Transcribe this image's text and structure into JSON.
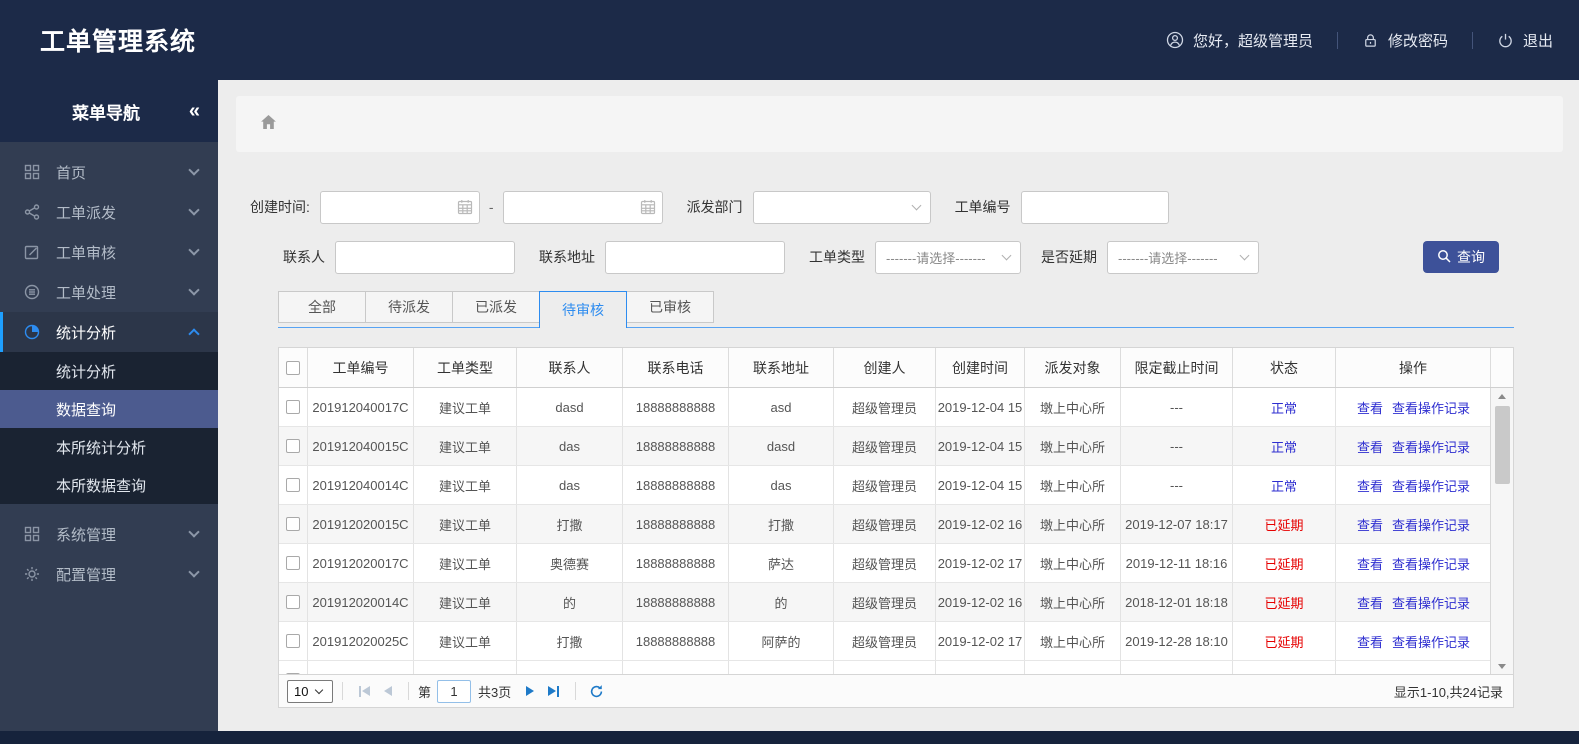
{
  "header": {
    "title": "工单管理系统",
    "greeting": "您好，超级管理员",
    "change_password": "修改密码",
    "logout": "退出"
  },
  "sidebar": {
    "title": "菜单导航",
    "collapse_glyph": "«",
    "menu": [
      {
        "type": "item",
        "icon": "grid-icon",
        "label": "首页"
      },
      {
        "type": "item",
        "icon": "share-icon",
        "label": "工单派发"
      },
      {
        "type": "item",
        "icon": "edit-icon",
        "label": "工单审核"
      },
      {
        "type": "item",
        "icon": "database-icon",
        "label": "工单处理"
      },
      {
        "type": "item",
        "icon": "pie-icon",
        "label": "统计分析",
        "active": true,
        "expanded": true
      },
      {
        "type": "subitem",
        "label": "统计分析"
      },
      {
        "type": "subitem",
        "label": "数据查询",
        "selected": true
      },
      {
        "type": "subitem",
        "label": "本所统计分析"
      },
      {
        "type": "subitem",
        "label": "本所数据查询"
      },
      {
        "type": "item",
        "icon": "grid-icon",
        "label": "系统管理"
      },
      {
        "type": "item",
        "icon": "gear-icon",
        "label": "配置管理"
      }
    ]
  },
  "filters": {
    "create_time_label": "创建时间:",
    "create_time_start": "",
    "create_time_end": "",
    "range_separator": "-",
    "dispatch_dept_label": "派发部门",
    "dispatch_dept_value": "",
    "order_no_label": "工单编号",
    "order_no_value": "",
    "contact_label": "联系人",
    "contact_value": "",
    "address_label": "联系地址",
    "address_value": "",
    "order_type_label": "工单类型",
    "order_type_value": "-------请选择-------",
    "delay_label": "是否延期",
    "delay_value": "-------请选择-------",
    "search_button": "查询"
  },
  "tabs": [
    {
      "label": "全部"
    },
    {
      "label": "待派发"
    },
    {
      "label": "已派发"
    },
    {
      "label": "待审核",
      "active": true
    },
    {
      "label": "已审核"
    }
  ],
  "table": {
    "columns": [
      "工单编号",
      "工单类型",
      "联系人",
      "联系电话",
      "联系地址",
      "创建人",
      "创建时间",
      "派发对象",
      "限定截止时间",
      "状态",
      "操作"
    ],
    "actions": {
      "view": "查看",
      "view_records": "查看操作记录"
    },
    "rows": [
      {
        "no": "201912040017C",
        "type": "建议工单",
        "contact": "dasd",
        "phone": "18888888888",
        "address": "asd",
        "creator": "超级管理员",
        "created": "2019-12-04 15",
        "target": "墩上中心所",
        "deadline": "---",
        "status": "正常",
        "delayed": false
      },
      {
        "no": "201912040015C",
        "type": "建议工单",
        "contact": "das",
        "phone": "18888888888",
        "address": "dasd",
        "creator": "超级管理员",
        "created": "2019-12-04 15",
        "target": "墩上中心所",
        "deadline": "---",
        "status": "正常",
        "delayed": false
      },
      {
        "no": "201912040014C",
        "type": "建议工单",
        "contact": "das",
        "phone": "18888888888",
        "address": "das",
        "creator": "超级管理员",
        "created": "2019-12-04 15",
        "target": "墩上中心所",
        "deadline": "---",
        "status": "正常",
        "delayed": false
      },
      {
        "no": "201912020015C",
        "type": "建议工单",
        "contact": "打撒",
        "phone": "18888888888",
        "address": "打撒",
        "creator": "超级管理员",
        "created": "2019-12-02 16",
        "target": "墩上中心所",
        "deadline": "2019-12-07 18:17",
        "status": "已延期",
        "delayed": true
      },
      {
        "no": "201912020017C",
        "type": "建议工单",
        "contact": "奥德赛",
        "phone": "18888888888",
        "address": "萨达",
        "creator": "超级管理员",
        "created": "2019-12-02 17",
        "target": "墩上中心所",
        "deadline": "2019-12-11 18:16",
        "status": "已延期",
        "delayed": true
      },
      {
        "no": "201912020014C",
        "type": "建议工单",
        "contact": "的",
        "phone": "18888888888",
        "address": "的",
        "creator": "超级管理员",
        "created": "2019-12-02 16",
        "target": "墩上中心所",
        "deadline": "2018-12-01 18:18",
        "status": "已延期",
        "delayed": true
      },
      {
        "no": "201912020025C",
        "type": "建议工单",
        "contact": "打撒",
        "phone": "18888888888",
        "address": "阿萨的",
        "creator": "超级管理员",
        "created": "2019-12-02 17",
        "target": "墩上中心所",
        "deadline": "2019-12-28 18:10",
        "status": "已延期",
        "delayed": true
      }
    ]
  },
  "pagination": {
    "page_size": "10",
    "page_prefix": "第",
    "current_page": "1",
    "total_pages": "共3页",
    "summary": "显示1-10,共24记录"
  },
  "colors": {
    "accent_blue": "#2d8cf0",
    "link_blue": "#2e2ed0",
    "status_delayed_red": "#e60000",
    "search_button_indigo": "#3d5199",
    "header_navy": "#1c2a48"
  }
}
